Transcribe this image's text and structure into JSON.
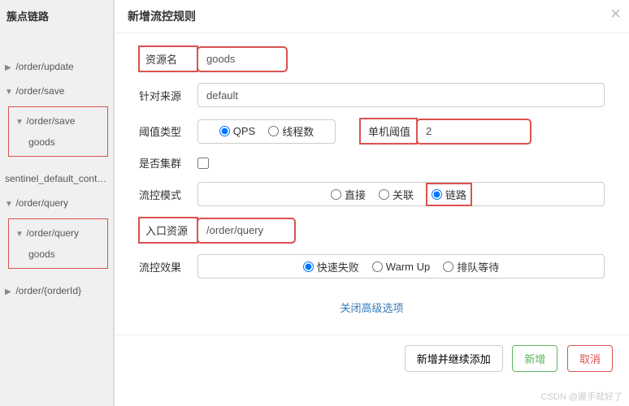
{
  "sidebar": {
    "title": "簇点链路",
    "items": [
      {
        "caret": "▶",
        "label": "/order/update"
      },
      {
        "caret": "▼",
        "label": "/order/save"
      },
      {
        "caret": "",
        "label": "sentinel_default_context"
      },
      {
        "caret": "▼",
        "label": "/order/query"
      },
      {
        "caret": "▶",
        "label": "/order/{orderId}"
      }
    ],
    "subgroup1": {
      "parent_caret": "▼",
      "parent": "/order/save",
      "child": "goods"
    },
    "subgroup2": {
      "parent_caret": "▼",
      "parent": "/order/query",
      "child": "goods"
    }
  },
  "modal": {
    "title": "新增流控规则",
    "close": "×",
    "fields": {
      "resource_label": "资源名",
      "resource_value": "goods",
      "source_label": "针对来源",
      "source_value": "default",
      "threshold_type_label": "阈值类型",
      "threshold_type_opts": {
        "qps": "QPS",
        "thread": "线程数"
      },
      "single_threshold_label": "单机阈值",
      "single_threshold_value": "2",
      "cluster_label": "是否集群",
      "mode_label": "流控模式",
      "mode_opts": {
        "direct": "直接",
        "relate": "关联",
        "chain": "链路"
      },
      "entry_label": "入口资源",
      "entry_value": "/order/query",
      "effect_label": "流控效果",
      "effect_opts": {
        "fail": "快速失败",
        "warmup": "Warm Up",
        "queue": "排队等待"
      }
    },
    "toggle_link": "关闭高级选项",
    "footer": {
      "add_continue": "新增并继续添加",
      "add": "新增",
      "cancel": "取消"
    }
  },
  "watermark": "CSDN @握手就好了"
}
